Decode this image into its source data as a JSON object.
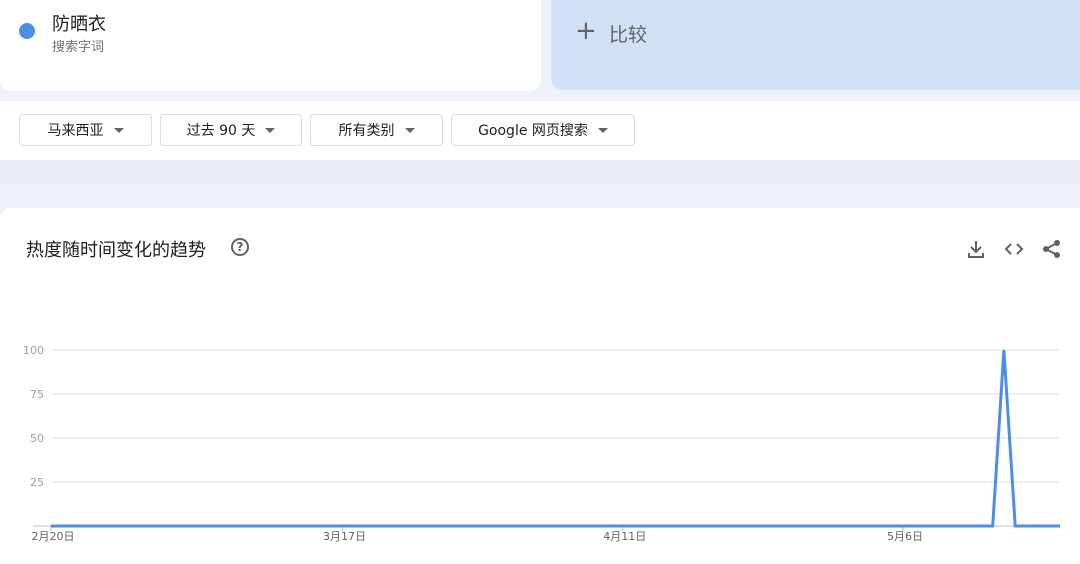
{
  "term": {
    "name": "防晒衣",
    "type": "搜索字词",
    "color": "#4e8fe6"
  },
  "compare": {
    "label": "比较"
  },
  "filters": [
    {
      "label": "马来西亚"
    },
    {
      "label": "过去 90 天"
    },
    {
      "label": "所有类别"
    },
    {
      "label": "Google 网页搜索"
    }
  ],
  "chart_section": {
    "title": "热度随时间变化的趋势",
    "help_glyph": "?",
    "tools": [
      "download-icon",
      "embed-code-icon",
      "share-icon"
    ]
  },
  "chart_data": {
    "type": "line",
    "x_tick_labels": [
      "2月20日",
      "3月17日",
      "4月11日",
      "5月6日"
    ],
    "x_tick_days": [
      0,
      26,
      51,
      76
    ],
    "total_days": 90,
    "y_ticks": [
      25,
      50,
      75,
      100
    ],
    "ylim": [
      0,
      100
    ],
    "grid": true,
    "series": [
      {
        "color": "#4e8fe6",
        "points": [
          [
            0,
            0
          ],
          [
            84,
            0
          ],
          [
            85,
            100
          ],
          [
            86,
            0
          ],
          [
            90,
            0
          ]
        ]
      }
    ]
  }
}
